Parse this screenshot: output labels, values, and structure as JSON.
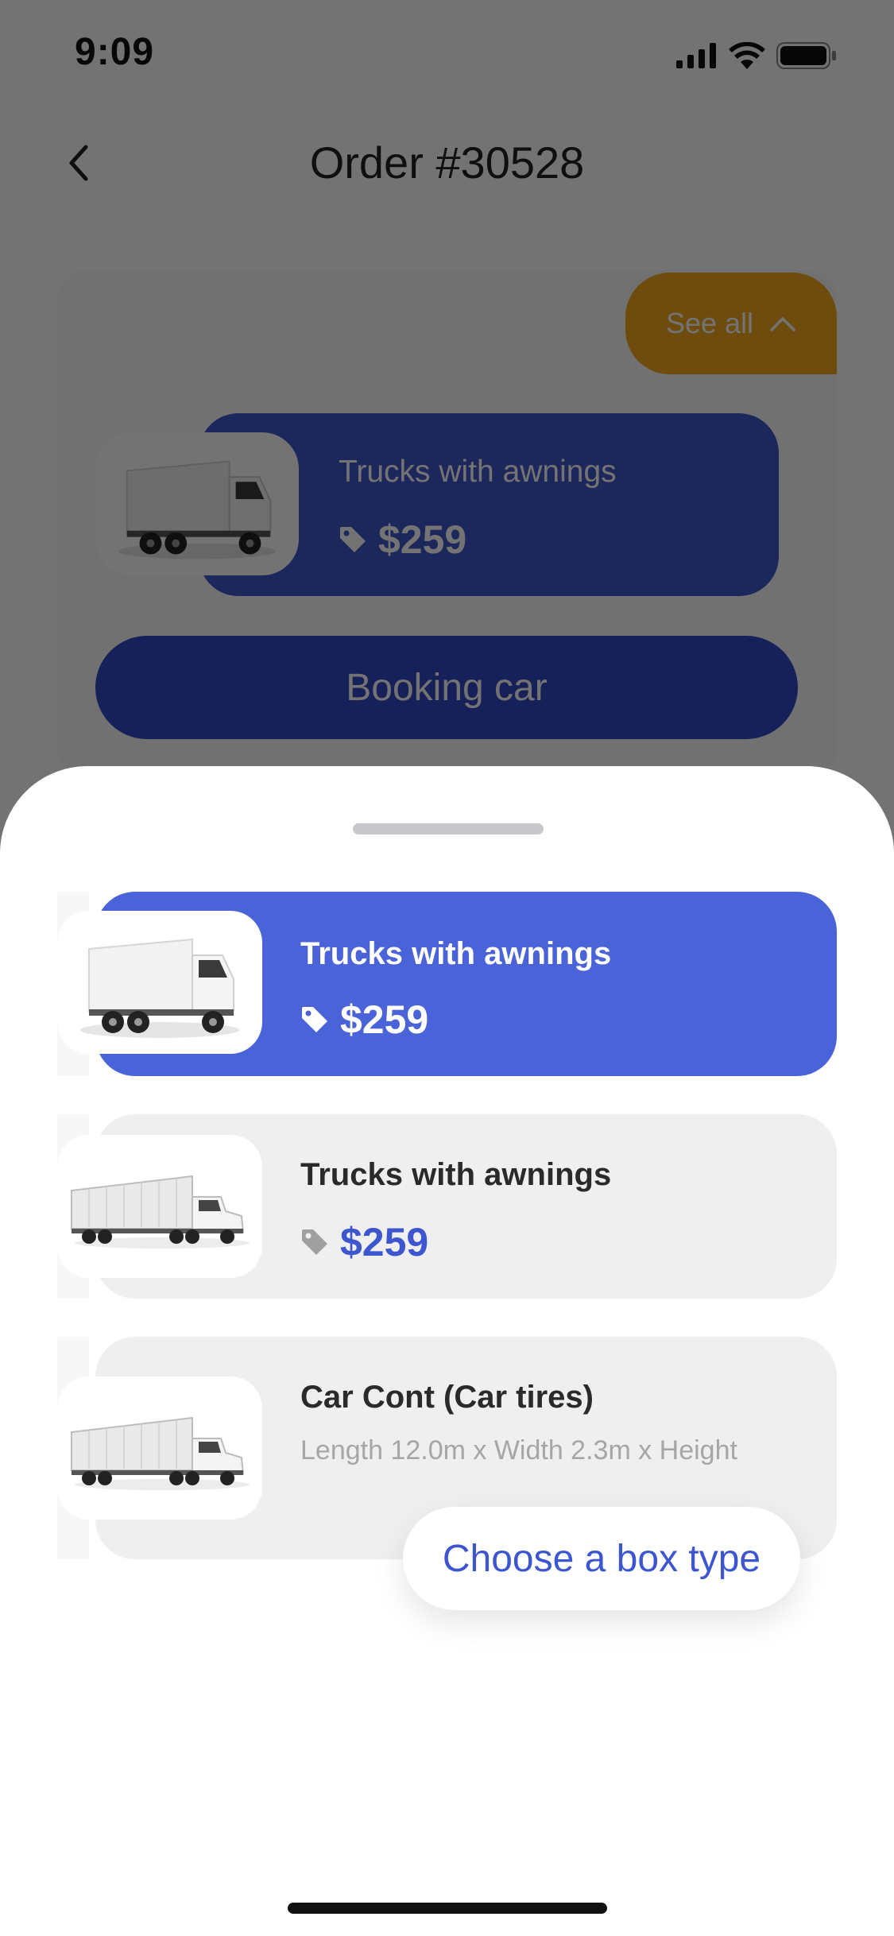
{
  "status_bar": {
    "time": "9:09"
  },
  "nav": {
    "title": "Order #30528"
  },
  "order_card": {
    "see_all_label": "See all",
    "selected_truck": {
      "name": "Trucks with awnings",
      "price": "$259"
    },
    "booking_label": "Booking car"
  },
  "sheet": {
    "options": [
      {
        "name": "Trucks with awnings",
        "price": "$259",
        "icon": "box-truck-image",
        "state": "selected"
      },
      {
        "name": "Trucks with awnings",
        "price": "$259",
        "icon": "semi-truck-image",
        "state": "default"
      },
      {
        "name": "Car Cont (Car tires)",
        "dimensions": "Length 12.0m x Width 2.3m x Height",
        "icon": "semi-truck-image",
        "state": "default"
      }
    ],
    "choose_box_label": "Choose a box type"
  },
  "colors": {
    "accent_blue": "#4a63d8",
    "dark_blue": "#3148c5",
    "orange": "#f3a81e",
    "option_bg": "#efefef"
  }
}
